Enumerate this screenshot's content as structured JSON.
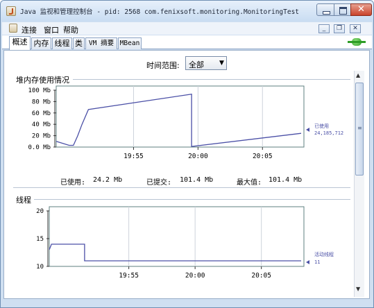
{
  "window": {
    "title": "Java 监视和管理控制台 - pid: 2568 com.fenixsoft.monitoring.MonitoringTest"
  },
  "menu": {
    "items": [
      "连接",
      "窗口",
      "帮助"
    ]
  },
  "tabs": [
    "概述",
    "内存",
    "线程",
    "类",
    "VM 摘要",
    "MBean"
  ],
  "time_range": {
    "label": "时间范围:",
    "selected": "全部"
  },
  "heap_panel": {
    "title": "堆内存使用情况",
    "used_label": "已使用:",
    "used_value": "24.2 Mb",
    "committed_label": "已提交:",
    "committed_value": "101.4 Mb",
    "max_label": "最大值:",
    "max_value": "101.4 Mb"
  },
  "threads_panel": {
    "title": "线程"
  },
  "colors": {
    "series": "#4a4fa6",
    "frame": "#5c7f7f",
    "grid": "#cdd3db"
  },
  "chart_data": [
    {
      "type": "line",
      "title": "堆内存使用情况",
      "x": [
        "19:49",
        "19:50",
        "19:50:20",
        "19:50:40",
        "19:51",
        "19:51:30",
        "19:59:30",
        "19:59:30",
        "20:08"
      ],
      "x_ticks": [
        "19:55",
        "20:00",
        "20:05"
      ],
      "y_ticks": [
        "0.0 Mb",
        "20 Mb",
        "40 Mb",
        "60 Mb",
        "80 Mb",
        "100 Mb"
      ],
      "ylim": [
        0,
        100
      ],
      "series": [
        {
          "name": "已使用",
          "values": [
            10,
            3,
            3,
            20,
            40,
            66,
            93,
            1,
            24.2
          ]
        }
      ],
      "legend_value": "24,185,712",
      "legend": "right"
    },
    {
      "type": "line",
      "title": "线程",
      "x": [
        "19:49",
        "19:49:10",
        "19:51:40",
        "19:51:40",
        "20:08"
      ],
      "x_ticks": [
        "19:55",
        "20:00",
        "20:05"
      ],
      "y_ticks": [
        "10",
        "15",
        "20"
      ],
      "ylim": [
        10,
        20
      ],
      "series": [
        {
          "name": "活动线程",
          "values": [
            13,
            14,
            14,
            11,
            11
          ]
        }
      ],
      "legend_value": "11",
      "legend": "right"
    }
  ]
}
